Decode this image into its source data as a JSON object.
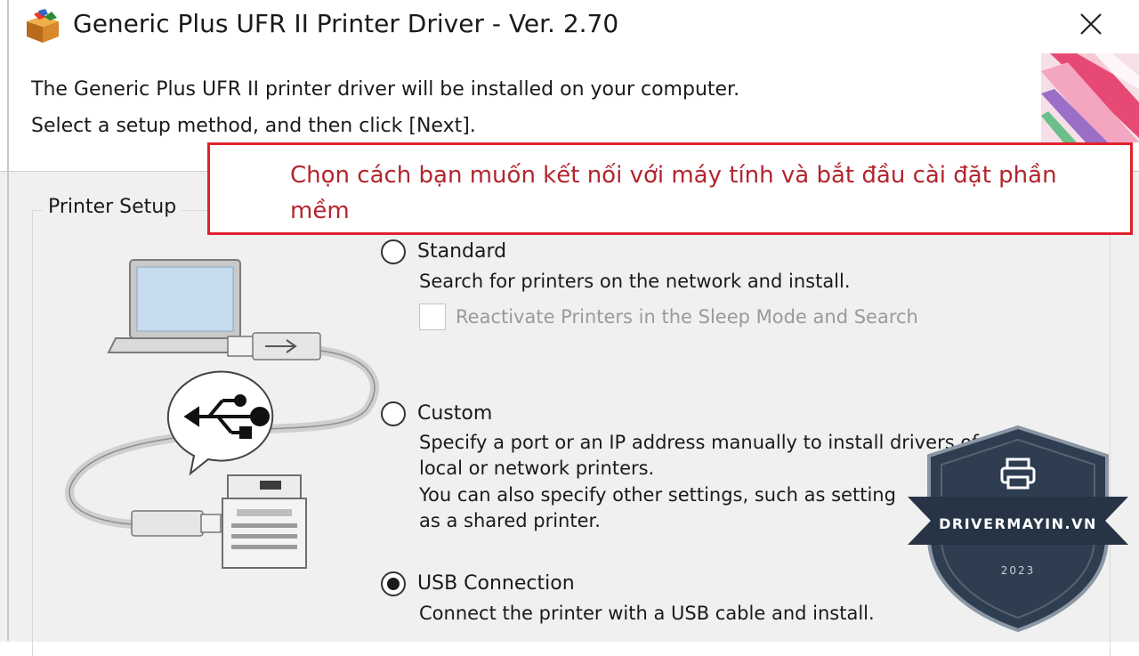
{
  "window": {
    "title": "Generic Plus UFR II Printer Driver - Ver. 2.70"
  },
  "intro": {
    "line1": "The Generic Plus UFR II printer driver will be installed on your computer.",
    "line2": "Select a setup method, and then click [Next]."
  },
  "annotation": {
    "text": "Chọn cách bạn muốn kết nối với máy tính và bắt đầu cài đặt phần mềm",
    "color": "#e0212d"
  },
  "printer_setup": {
    "group_label": "Printer Setup",
    "options": [
      {
        "label": "Standard",
        "selected": false,
        "desc": "Search for printers on the network and install.",
        "checkbox_label": "Reactivate Printers in the Sleep Mode and Search",
        "checkbox_checked": false,
        "checkbox_enabled": false
      },
      {
        "label": "Custom",
        "selected": false,
        "desc_lines": [
          "Specify a port or an IP address manually to install drivers of",
          "local or network printers.",
          "You can also specify other settings, such as setting",
          "as a shared printer."
        ]
      },
      {
        "label": "USB Connection",
        "selected": true,
        "desc": "Connect the printer with a USB cable and install."
      }
    ]
  },
  "watermark": {
    "brand": "DRIVERMAYIN.VN",
    "year": "2023"
  },
  "icons": [
    "installer-box-icon",
    "close-icon",
    "laptop-usb-printer-illustration",
    "printer-icon"
  ]
}
